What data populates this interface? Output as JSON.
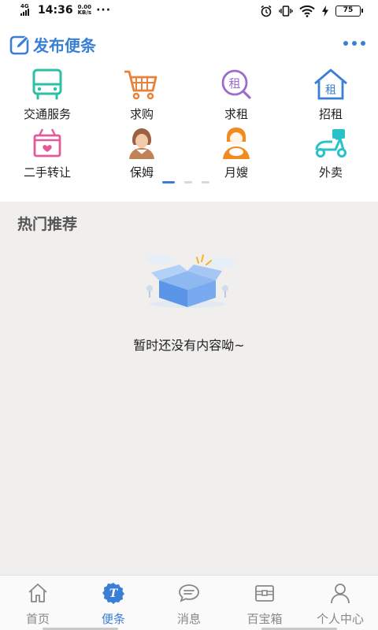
{
  "status_bar": {
    "network": "4G",
    "time": "14:36",
    "speed_value": "0.00",
    "speed_unit": "KB/s",
    "dots": "···",
    "battery": "75"
  },
  "header": {
    "title": "发布便条"
  },
  "services": [
    {
      "label": "交通服务",
      "icon": "bus-icon"
    },
    {
      "label": "求购",
      "icon": "shopping-cart-icon"
    },
    {
      "label": "求租",
      "icon": "rent-search-icon"
    },
    {
      "label": "招租",
      "icon": "house-rent-icon"
    },
    {
      "label": "二手转让",
      "icon": "secondhand-box-icon"
    },
    {
      "label": "保姆",
      "icon": "nanny-icon"
    },
    {
      "label": "月嫂",
      "icon": "maternity-nurse-icon"
    },
    {
      "label": "外卖",
      "icon": "delivery-scooter-icon"
    }
  ],
  "pager": {
    "pages": 3,
    "current": 1
  },
  "section": {
    "title": "热门推荐"
  },
  "empty_state": {
    "text": "暂时还没有内容呦~"
  },
  "tabs": [
    {
      "label": "首页",
      "icon": "home-icon"
    },
    {
      "label": "便条",
      "icon": "note-badge-icon",
      "active": true
    },
    {
      "label": "消息",
      "icon": "message-icon"
    },
    {
      "label": "百宝箱",
      "icon": "treasure-box-icon"
    },
    {
      "label": "个人中心",
      "icon": "person-icon"
    }
  ],
  "colors": {
    "accent": "#3a7fd5",
    "bus": "#2bbfa4",
    "cart": "#e8823a",
    "rent": "#9b6cc9",
    "house": "#3a7fd5",
    "secondhand": "#e25a9a",
    "nanny": "#c08257",
    "nurse": "#f28a20",
    "scooter": "#28c2c8"
  }
}
